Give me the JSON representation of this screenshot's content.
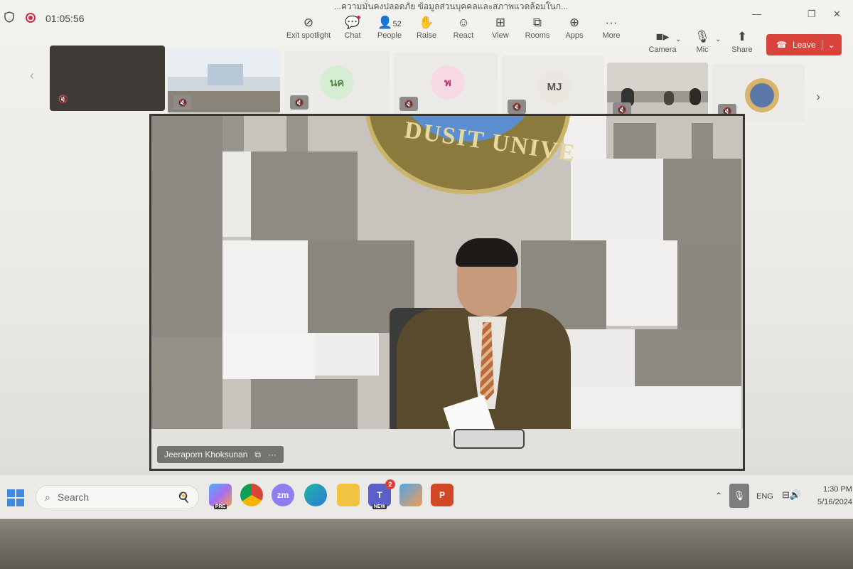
{
  "titlebar": {
    "timer": "01:05:56",
    "meeting_title": "...ความมั่นคงปลอดภัย ข้อมูลส่วนบุคคลและสภาพแวดล้อมในก...",
    "minimize": "—",
    "restore": "❐",
    "close": "✕"
  },
  "toolbar": {
    "items": [
      {
        "label": "Exit spotlight",
        "icon": "exit-spotlight-icon",
        "glyph": "⊘"
      },
      {
        "label": "Chat",
        "icon": "chat-icon",
        "glyph": "💬"
      },
      {
        "label": "People",
        "icon": "people-icon",
        "glyph": "👤",
        "count": "52"
      },
      {
        "label": "Raise",
        "icon": "raise-hand-icon",
        "glyph": "✋"
      },
      {
        "label": "React",
        "icon": "react-icon",
        "glyph": "☺"
      },
      {
        "label": "View",
        "icon": "view-icon",
        "glyph": "⊞"
      },
      {
        "label": "Rooms",
        "icon": "rooms-icon",
        "glyph": "⧉"
      },
      {
        "label": "Apps",
        "icon": "apps-icon",
        "glyph": "⊕"
      },
      {
        "label": "More",
        "icon": "more-icon",
        "glyph": "···"
      }
    ],
    "camera": "Camera",
    "mic": "Mic",
    "share": "Share",
    "leave": "Leave"
  },
  "participants": [
    {
      "type": "video-dark"
    },
    {
      "type": "video-room"
    },
    {
      "type": "avatar",
      "initials": "นค",
      "bg": "#d6ecd3",
      "fg": "#4e8a3f"
    },
    {
      "type": "avatar",
      "initials": "พ",
      "bg": "#f6d9e4",
      "fg": "#c2356b"
    },
    {
      "type": "avatar",
      "initials": "MJ",
      "bg": "#ebe6df",
      "fg": "#555555"
    },
    {
      "type": "video-room2"
    },
    {
      "type": "photo"
    }
  ],
  "main_video": {
    "speaker_name": "Jeeraporn Khoksunan",
    "seal_text": "DUSIT UNIVE"
  },
  "taskbar": {
    "search_placeholder": "Search",
    "zoom_label": "zm",
    "teams_badge": "2",
    "teams_new": "NEW",
    "copilot_pre": "PRE",
    "language": "ENG",
    "time": "1:30 PM",
    "date": "5/16/2024"
  }
}
